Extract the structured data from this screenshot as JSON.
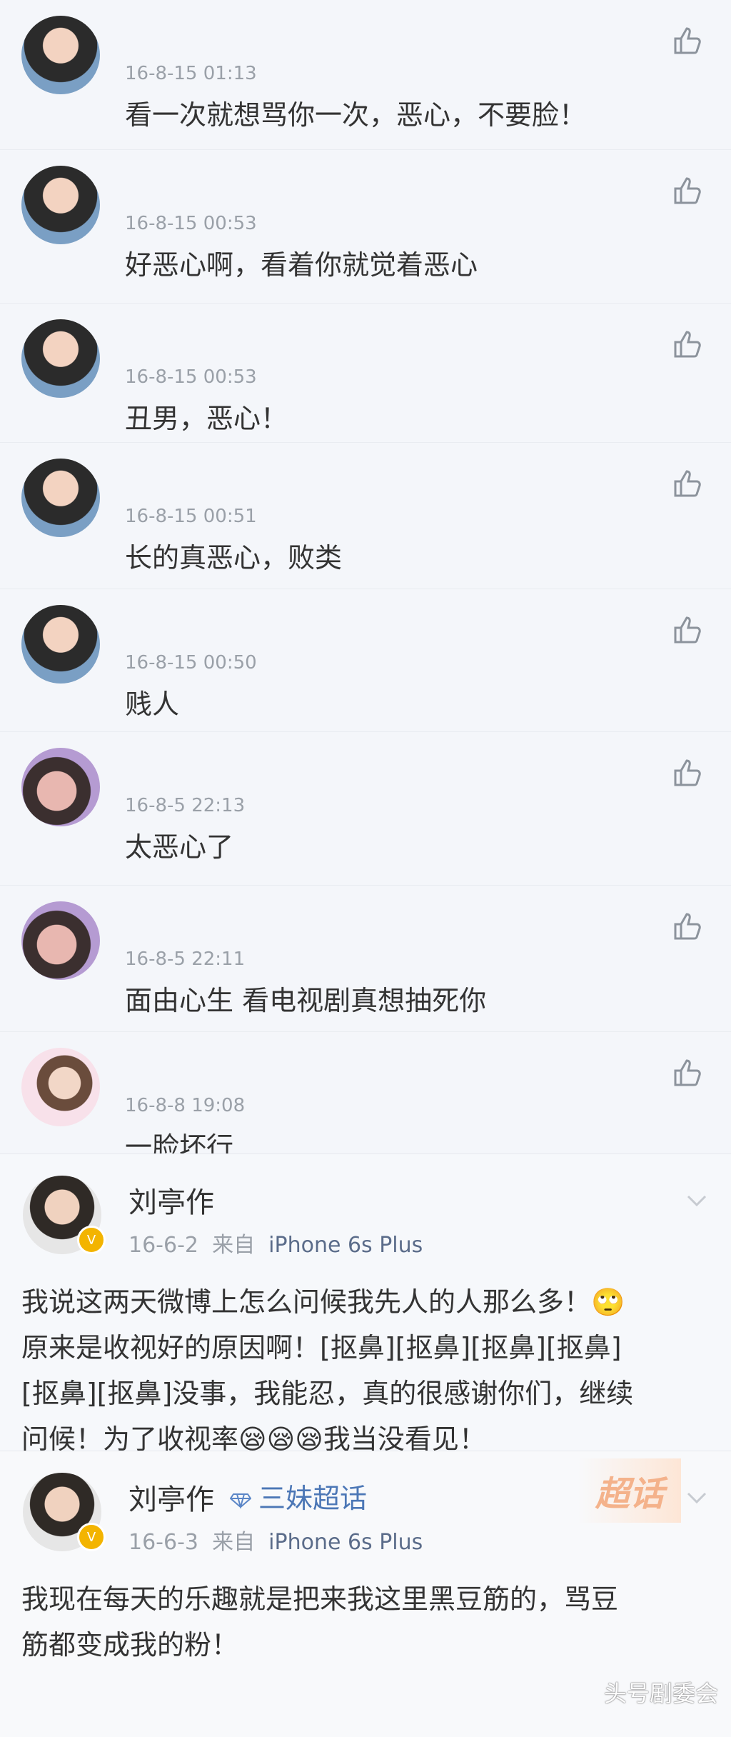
{
  "comments": [
    {
      "time": "16-8-15 01:13",
      "text": "看一次就想骂你一次，恶心，不要脸！"
    },
    {
      "time": "16-8-15 00:53",
      "text": "好恶心啊，看着你就觉着恶心"
    },
    {
      "time": "16-8-15 00:53",
      "text": "丑男，恶心！"
    },
    {
      "time": "16-8-15 00:51",
      "text": "长的真恶心，败类"
    },
    {
      "time": "16-8-15 00:50",
      "text": "贱人"
    },
    {
      "time": "16-8-5 22:13",
      "text": "太恶心了"
    },
    {
      "time": "16-8-5 22:11",
      "text": "面由心生 看电视剧真想抽死你"
    },
    {
      "time": "16-8-8 19:08",
      "text": "一脸坏行"
    }
  ],
  "post1": {
    "name": "刘亭作",
    "date": "16-6-2",
    "from": "来自",
    "device": "iPhone 6s Plus",
    "body": "我说这两天微博上怎么问候我先人的人那么多！🙄\n原来是收视好的原因啊！[抠鼻][抠鼻][抠鼻][抠鼻]\n[抠鼻][抠鼻]没事，我能忍，真的很感谢你们，继续\n问候！为了收视率😪😪😪我当没看见！"
  },
  "post2": {
    "name": "刘亭作",
    "topic": "三妹超话",
    "super_label": "超话",
    "date": "16-6-3",
    "from": "来自",
    "device": "iPhone 6s Plus",
    "body": "我现在每天的乐趣就是把来我这里黑豆筋的，骂豆\n筋都变成我的粉！"
  },
  "watermark": "头号剧委会"
}
